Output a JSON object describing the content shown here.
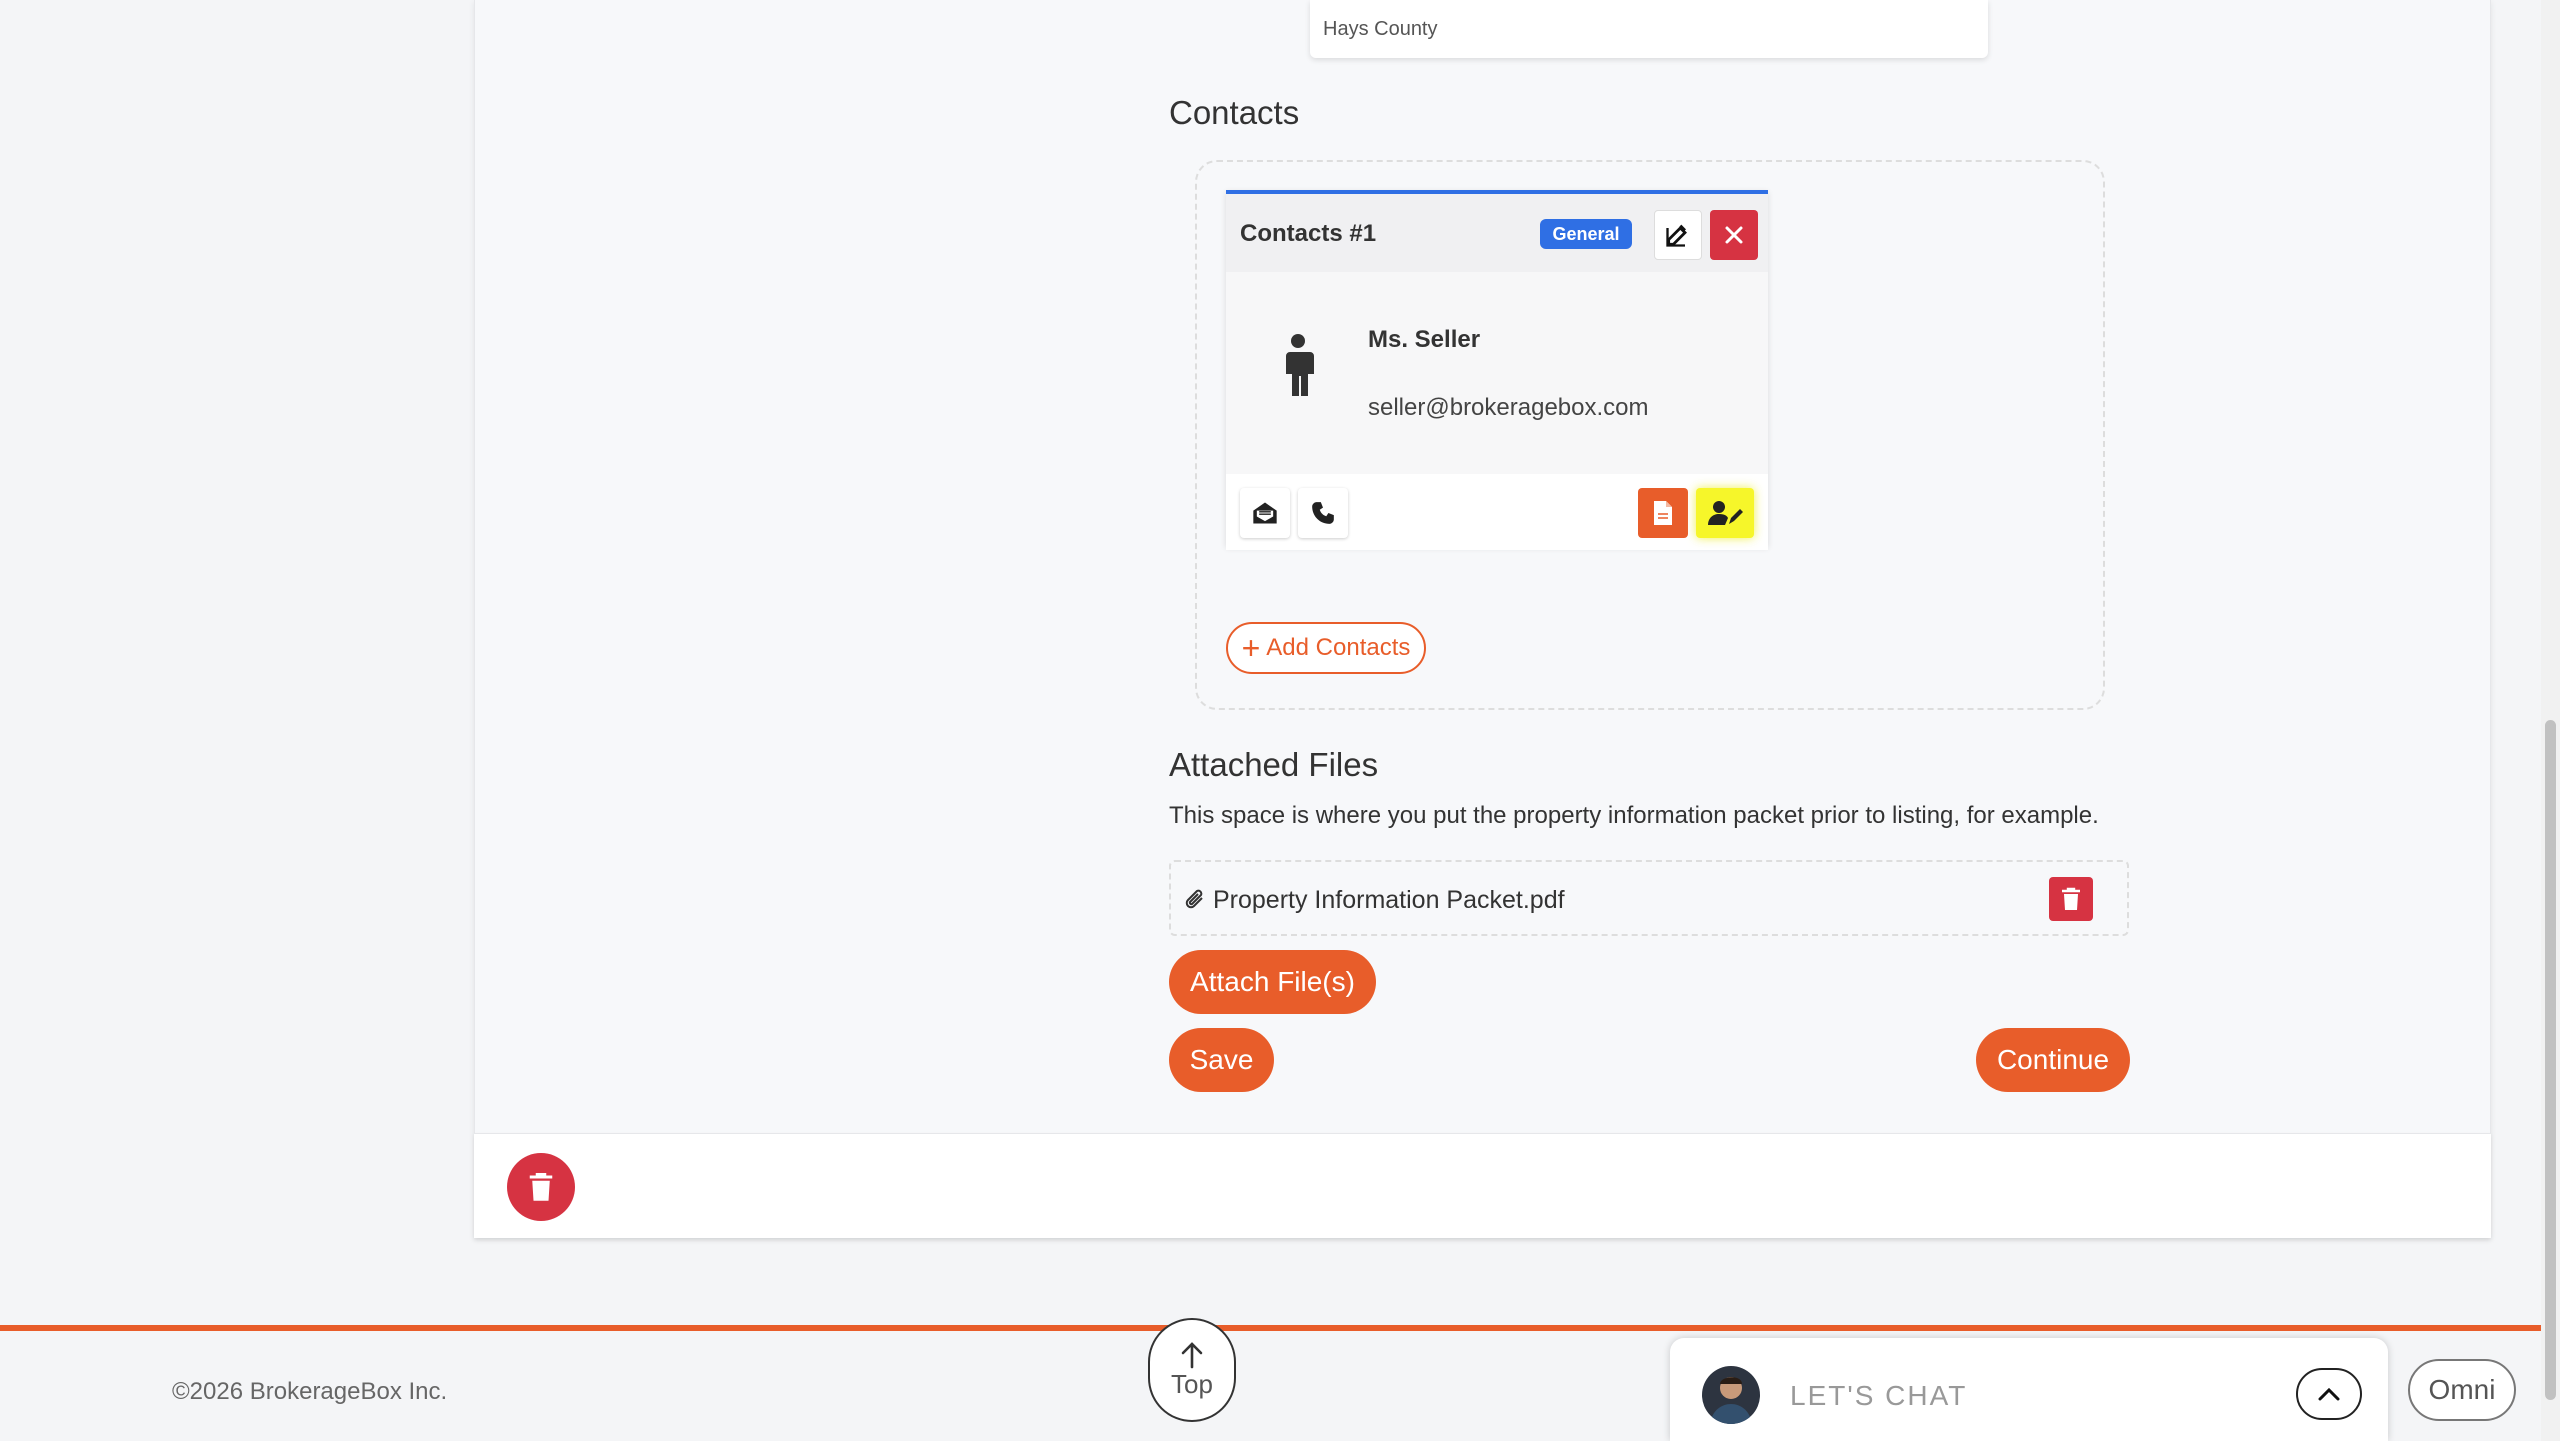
{
  "location": {
    "county": "Hays County"
  },
  "contacts_section": {
    "title": "Contacts",
    "card": {
      "title": "Contacts #1",
      "badge": "General",
      "name": "Ms. Seller",
      "email": "seller@brokeragebox.com"
    },
    "add_label": "Add Contacts",
    "add_icon": "+"
  },
  "files_section": {
    "title": "Attached Files",
    "description": "This space is where you put the property information packet prior to listing, for example.",
    "files": [
      {
        "name": "Property Information Packet.pdf"
      }
    ],
    "attach_label": "Attach File(s)"
  },
  "actions": {
    "save_label": "Save",
    "continue_label": "Continue"
  },
  "footer": {
    "copyright": "©2026 BrokerageBox Inc.",
    "top_label": "Top",
    "chat_label": "LET'S CHAT",
    "omni_label": "Omni"
  },
  "colors": {
    "accent": "#e85d2a",
    "danger": "#d63342",
    "primary": "#2f6fe4",
    "highlight": "#f6f62a"
  }
}
